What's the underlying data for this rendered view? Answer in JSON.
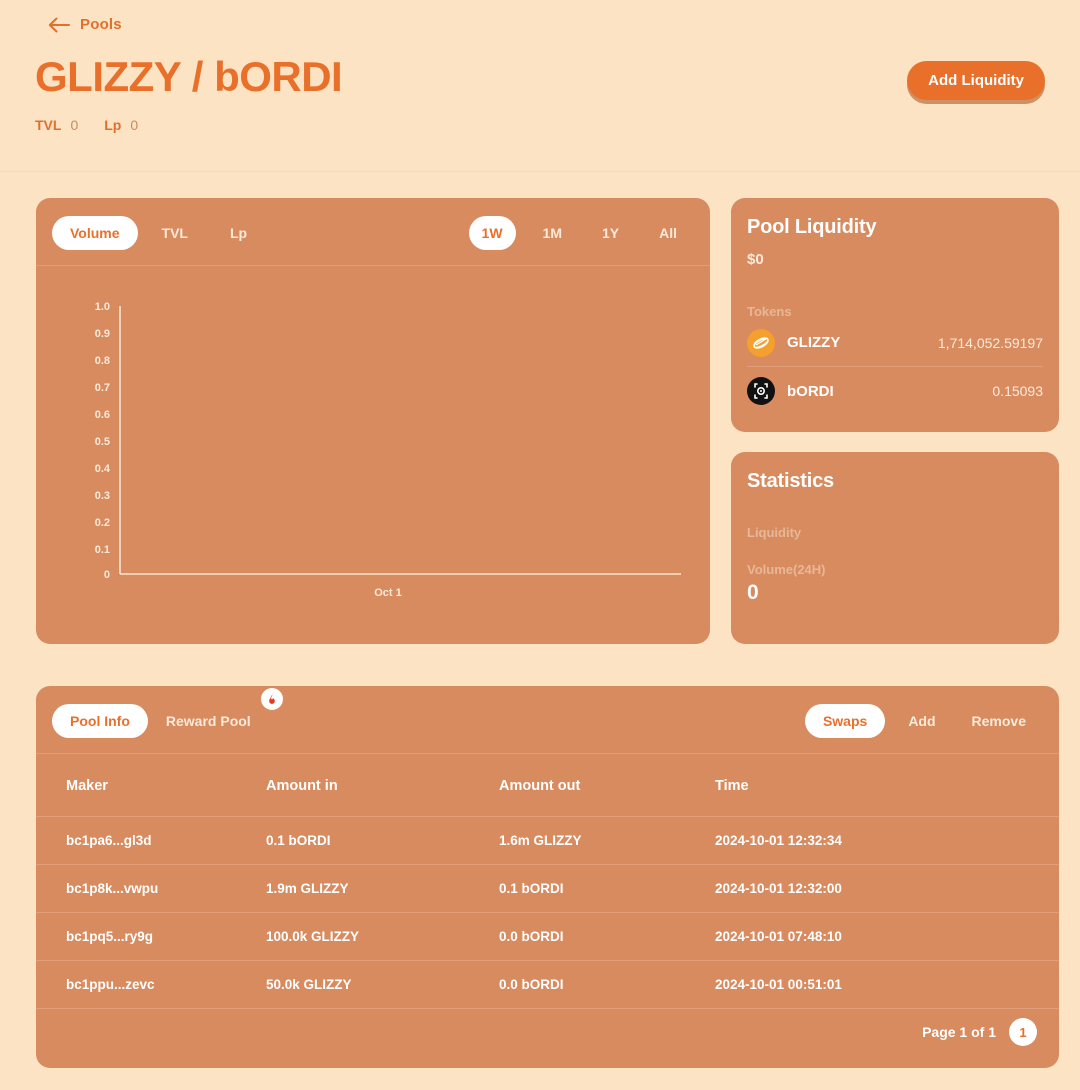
{
  "header": {
    "back_label": "Pools",
    "back_icon": "arrow-left-icon",
    "title": "GLIZZY / bORDI",
    "stats": [
      {
        "key": "TVL",
        "value": "0"
      },
      {
        "key": "Lp",
        "value": "0"
      }
    ],
    "add_liquidity_label": "Add Liquidity"
  },
  "chart_card": {
    "metric_tabs": [
      {
        "label": "Volume",
        "active": true
      },
      {
        "label": "TVL",
        "active": false
      },
      {
        "label": "Lp",
        "active": false
      }
    ],
    "range_tabs": [
      {
        "label": "1W",
        "active": true
      },
      {
        "label": "1M",
        "active": false
      },
      {
        "label": "1Y",
        "active": false
      },
      {
        "label": "All",
        "active": false
      }
    ]
  },
  "chart_data": {
    "type": "line",
    "title": "Volume",
    "xlabel": "",
    "ylabel": "",
    "x": [
      "Oct 1"
    ],
    "series": [
      {
        "name": "Volume",
        "values": [
          0
        ]
      }
    ],
    "ylim": [
      0,
      1.0
    ],
    "y_ticks": [
      "1.0",
      "0.9",
      "0.8",
      "0.7",
      "0.6",
      "0.5",
      "0.4",
      "0.3",
      "0.2",
      "0.1",
      "0"
    ],
    "x_ticks": [
      "Oct 1"
    ],
    "grid": false,
    "legend": "none",
    "axis_color": "#F5E4D2"
  },
  "pool_liquidity": {
    "title": "Pool Liquidity",
    "amount": "$0",
    "tokens_label": "Tokens",
    "tokens": [
      {
        "icon": "hotdog-icon",
        "name": "GLIZZY",
        "amount": "1,714,052.59197",
        "icon_bg": "#F5A02E"
      },
      {
        "icon": "bordi-bracket-icon",
        "name": "bORDI",
        "amount": "0.15093",
        "icon_bg": "#111111"
      }
    ]
  },
  "statistics": {
    "title": "Statistics",
    "items": [
      {
        "label": "Liquidity",
        "value": ""
      },
      {
        "label": "Volume(24H)",
        "value": "0"
      }
    ]
  },
  "bottom_panel": {
    "left_tabs": [
      {
        "label": "Pool Info",
        "active": true,
        "badge": ""
      },
      {
        "label": "Reward Pool",
        "active": false,
        "badge": "fire-icon"
      }
    ],
    "right_tabs": [
      {
        "label": "Swaps",
        "active": true
      },
      {
        "label": "Add",
        "active": false
      },
      {
        "label": "Remove",
        "active": false
      }
    ],
    "table": {
      "columns": [
        "Maker",
        "Amount in",
        "Amount out",
        "Time"
      ],
      "rows": [
        {
          "maker": "bc1pa6...gl3d",
          "amount_in": "0.1 bORDI",
          "amount_out": "1.6m GLIZZY",
          "time": "2024-10-01 12:32:34"
        },
        {
          "maker": "bc1p8k...vwpu",
          "amount_in": "1.9m GLIZZY",
          "amount_out": "0.1 bORDI",
          "time": "2024-10-01 12:32:00"
        },
        {
          "maker": "bc1pq5...ry9g",
          "amount_in": "100.0k GLIZZY",
          "amount_out": "0.0 bORDI",
          "time": "2024-10-01 07:48:10"
        },
        {
          "maker": "bc1ppu...zevc",
          "amount_in": "50.0k GLIZZY",
          "amount_out": "0.0 bORDI",
          "time": "2024-10-01 00:51:01"
        }
      ]
    },
    "pagination": {
      "text": "Page 1 of 1",
      "current": "1"
    }
  },
  "colors": {
    "page_bg": "#FCE3C4",
    "card_bg": "#D78B5F",
    "accent": "#E8702A",
    "text_light": "#FBEADA"
  }
}
